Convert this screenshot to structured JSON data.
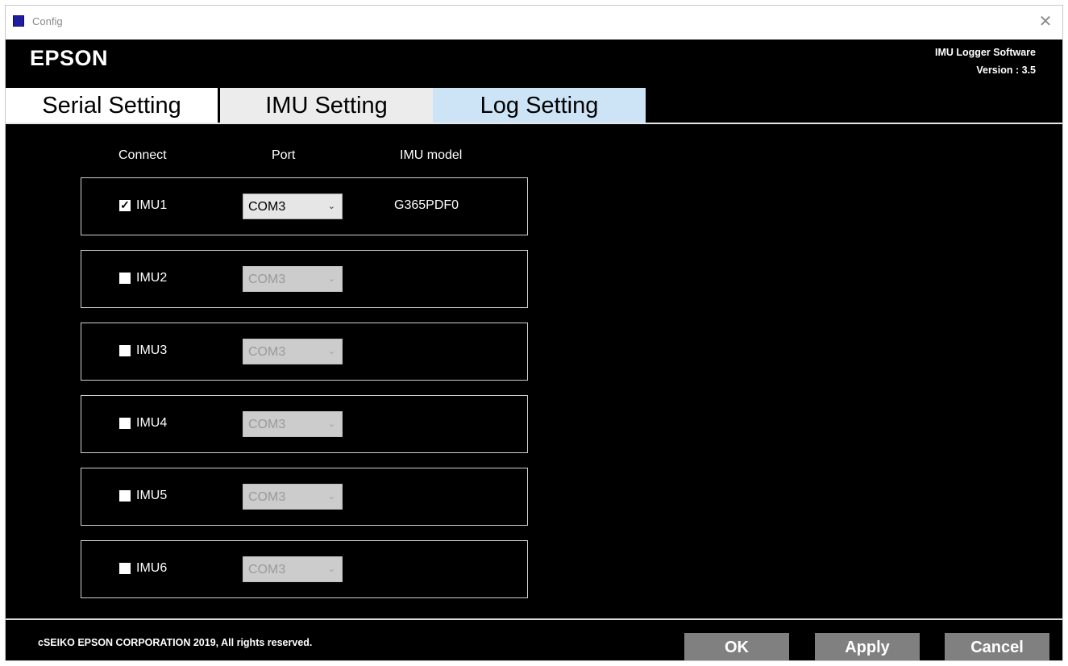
{
  "window": {
    "title": "Config",
    "close_glyph": "✕"
  },
  "header": {
    "brand": "EPSON",
    "app_name": "IMU Logger Software",
    "version_text": "Version : 3.5"
  },
  "tabs": [
    {
      "label": "Serial Setting",
      "active": true
    },
    {
      "label": "IMU Setting",
      "active": false
    },
    {
      "label": "Log Setting",
      "active": false
    }
  ],
  "columns": {
    "connect": "Connect",
    "port": "Port",
    "model": "IMU model"
  },
  "imus": [
    {
      "label": "IMU1",
      "checked": true,
      "port": "COM3",
      "enabled": true,
      "model": "G365PDF0"
    },
    {
      "label": "IMU2",
      "checked": false,
      "port": "COM3",
      "enabled": false,
      "model": ""
    },
    {
      "label": "IMU3",
      "checked": false,
      "port": "COM3",
      "enabled": false,
      "model": ""
    },
    {
      "label": "IMU4",
      "checked": false,
      "port": "COM3",
      "enabled": false,
      "model": ""
    },
    {
      "label": "IMU5",
      "checked": false,
      "port": "COM3",
      "enabled": false,
      "model": ""
    },
    {
      "label": "IMU6",
      "checked": false,
      "port": "COM3",
      "enabled": false,
      "model": ""
    }
  ],
  "icons": {
    "checkbox_check": "✓",
    "dropdown_chevron": "⌄"
  },
  "footer": {
    "copyright": "cSEIKO EPSON CORPORATION 2019, All rights reserved.",
    "ok_label": "OK",
    "apply_label": "Apply",
    "cancel_label": "Cancel"
  },
  "colors": {
    "background": "#000000",
    "tab_log_bg": "#cde4f7",
    "button_bg": "#808080"
  }
}
